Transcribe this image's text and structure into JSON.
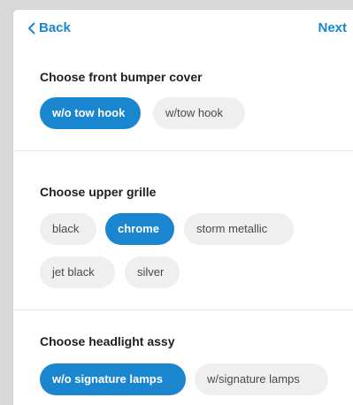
{
  "nav": {
    "back_label": "Back",
    "next_label": "Next"
  },
  "colors": {
    "accent": "#1a86d0",
    "chip_bg": "#efefef",
    "chip_text": "#4a4a4a"
  },
  "sections": [
    {
      "title": "Choose front bumper cover",
      "options": [
        {
          "label": "w/o tow hook",
          "selected": true
        },
        {
          "label": "w/tow hook",
          "selected": false
        }
      ]
    },
    {
      "title": "Choose upper grille",
      "options": [
        {
          "label": "black",
          "selected": false
        },
        {
          "label": "chrome",
          "selected": true
        },
        {
          "label": "storm metallic",
          "selected": false
        },
        {
          "label": "jet black",
          "selected": false
        },
        {
          "label": "silver",
          "selected": false
        }
      ]
    },
    {
      "title": "Choose headlight assy",
      "options": [
        {
          "label": "w/o signature lamps",
          "selected": true
        },
        {
          "label": "w/signature lamps",
          "selected": false
        }
      ]
    }
  ]
}
